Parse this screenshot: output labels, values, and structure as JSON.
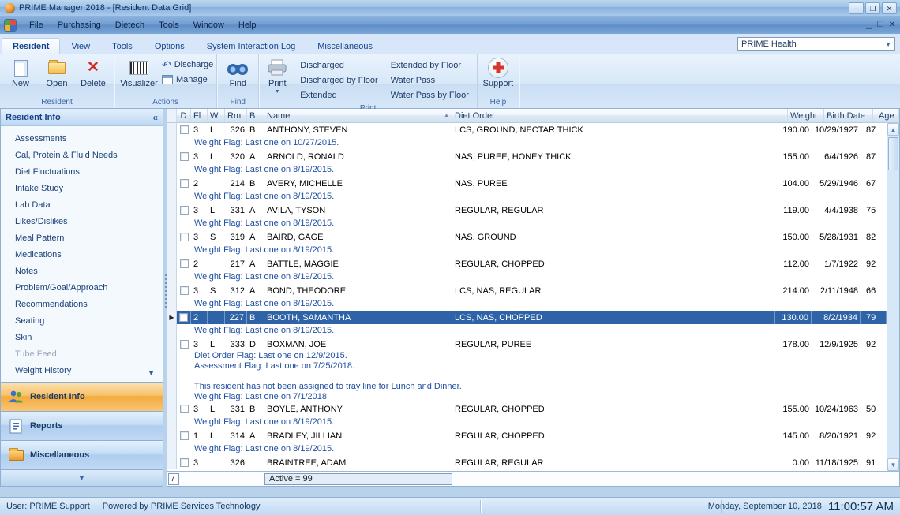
{
  "window": {
    "title": "PRIME Manager 2018 - [Resident Data Grid]"
  },
  "menu": {
    "items": [
      "File",
      "Purchasing",
      "Dietech",
      "Tools",
      "Window",
      "Help"
    ]
  },
  "ribbon": {
    "tabs": [
      {
        "label": "Resident",
        "active": true
      },
      {
        "label": "View",
        "active": false
      },
      {
        "label": "Tools",
        "active": false
      },
      {
        "label": "Options",
        "active": false
      },
      {
        "label": "System Interaction Log",
        "active": false
      },
      {
        "label": "Miscellaneous",
        "active": false
      }
    ],
    "profile": "PRIME Health",
    "groups": {
      "resident": {
        "label": "Resident",
        "new": "New",
        "open": "Open",
        "delete": "Delete"
      },
      "actions": {
        "label": "Actions",
        "visualizer": "Visualizer",
        "discharge": "Discharge",
        "manage": "Manage"
      },
      "find": {
        "label": "Find",
        "find": "Find"
      },
      "print": {
        "label": "Print",
        "print": "Print",
        "options": [
          "Discharged",
          "Discharged by Floor",
          "Extended",
          "Extended by Floor",
          "Water Pass",
          "Water Pass by Floor"
        ]
      },
      "help": {
        "label": "Help",
        "support": "Support"
      }
    }
  },
  "sidebar": {
    "header": "Resident Info",
    "collapse_glyph": "«",
    "items": [
      {
        "label": "Assessments"
      },
      {
        "label": "Cal, Protein & Fluid Needs"
      },
      {
        "label": "Diet Fluctuations"
      },
      {
        "label": "Intake Study"
      },
      {
        "label": "Lab Data"
      },
      {
        "label": "Likes/Dislikes"
      },
      {
        "label": "Meal Pattern"
      },
      {
        "label": "Medications"
      },
      {
        "label": "Notes"
      },
      {
        "label": "Problem/Goal/Approach"
      },
      {
        "label": "Recommendations"
      },
      {
        "label": "Seating"
      },
      {
        "label": "Skin"
      },
      {
        "label": "Tube Feed",
        "muted": true
      },
      {
        "label": "Weight History"
      }
    ],
    "nav": [
      {
        "label": "Resident Info",
        "active": true
      },
      {
        "label": "Reports",
        "active": false
      },
      {
        "label": "Miscellaneous",
        "active": false
      }
    ]
  },
  "grid": {
    "columns": [
      "D",
      "Fl",
      "W",
      "Rm",
      "B",
      "Name",
      "Diet Order",
      "Weight",
      "Birth Date",
      "Age"
    ],
    "sorted_column": "Name",
    "rows": [
      {
        "type": "data",
        "fl": "3",
        "w": "L",
        "rm": "326",
        "b": "B",
        "name": "ANTHONY, STEVEN",
        "diet": "LCS, GROUND, NECTAR THICK",
        "weight": "190.00",
        "birth": "10/29/1927",
        "age": "87"
      },
      {
        "type": "flag",
        "lines": [
          "Weight Flag: Last one on 10/27/2015."
        ]
      },
      {
        "type": "data",
        "fl": "3",
        "w": "L",
        "rm": "320",
        "b": "A",
        "name": "ARNOLD, RONALD",
        "diet": "NAS, PUREE, HONEY THICK",
        "weight": "155.00",
        "birth": "6/4/1926",
        "age": "87"
      },
      {
        "type": "flag",
        "lines": [
          "Weight Flag: Last one on 8/19/2015."
        ]
      },
      {
        "type": "data",
        "fl": "2",
        "w": "",
        "rm": "214",
        "b": "B",
        "name": "AVERY, MICHELLE",
        "diet": "NAS, PUREE",
        "weight": "104.00",
        "birth": "5/29/1946",
        "age": "67"
      },
      {
        "type": "flag",
        "lines": [
          "Weight Flag: Last one on 8/19/2015."
        ]
      },
      {
        "type": "data",
        "fl": "3",
        "w": "L",
        "rm": "331",
        "b": "A",
        "name": "AVILA, TYSON",
        "diet": "REGULAR, REGULAR",
        "weight": "119.00",
        "birth": "4/4/1938",
        "age": "75"
      },
      {
        "type": "flag",
        "lines": [
          "Weight Flag: Last one on 8/19/2015."
        ]
      },
      {
        "type": "data",
        "fl": "3",
        "w": "S",
        "rm": "319",
        "b": "A",
        "name": "BAIRD, GAGE",
        "diet": "NAS, GROUND",
        "weight": "150.00",
        "birth": "5/28/1931",
        "age": "82"
      },
      {
        "type": "flag",
        "lines": [
          "Weight Flag: Last one on 8/19/2015."
        ]
      },
      {
        "type": "data",
        "fl": "2",
        "w": "",
        "rm": "217",
        "b": "A",
        "name": "BATTLE, MAGGIE",
        "diet": "REGULAR, CHOPPED",
        "weight": "112.00",
        "birth": "1/7/1922",
        "age": "92"
      },
      {
        "type": "flag",
        "lines": [
          "Weight Flag: Last one on 8/19/2015."
        ]
      },
      {
        "type": "data",
        "fl": "3",
        "w": "S",
        "rm": "312",
        "b": "A",
        "name": "BOND, THEODORE",
        "diet": "LCS, NAS, REGULAR",
        "weight": "214.00",
        "birth": "2/11/1948",
        "age": "66"
      },
      {
        "type": "flag",
        "lines": [
          "Weight Flag: Last one on 8/19/2015."
        ]
      },
      {
        "type": "data",
        "selected": true,
        "fl": "2",
        "w": "",
        "rm": "227",
        "b": "B",
        "name": "BOOTH, SAMANTHA",
        "diet": "LCS, NAS, CHOPPED",
        "weight": "130.00",
        "birth": "8/2/1934",
        "age": "79"
      },
      {
        "type": "flag",
        "lines": [
          "Weight Flag: Last one on 8/19/2015."
        ]
      },
      {
        "type": "data",
        "fl": "3",
        "w": "L",
        "rm": "333",
        "b": "D",
        "name": "BOXMAN, JOE",
        "diet": "REGULAR, PUREE",
        "weight": "178.00",
        "birth": "12/9/1925",
        "age": "92"
      },
      {
        "type": "flag",
        "lines": [
          "Diet Order Flag: Last one on 12/9/2015.",
          "Assessment Flag: Last one on 7/25/2018.",
          "",
          "This resident has not been assigned to tray line for Lunch and Dinner.",
          "Weight Flag: Last one on 7/1/2018."
        ]
      },
      {
        "type": "data",
        "fl": "3",
        "w": "L",
        "rm": "331",
        "b": "B",
        "name": "BOYLE, ANTHONY",
        "diet": "REGULAR, CHOPPED",
        "weight": "155.00",
        "birth": "10/24/1963",
        "age": "50"
      },
      {
        "type": "flag",
        "lines": [
          "Weight Flag: Last one on 8/19/2015."
        ]
      },
      {
        "type": "data",
        "fl": "1",
        "w": "L",
        "rm": "314",
        "b": "A",
        "name": "BRADLEY, JILLIAN",
        "diet": "REGULAR, CHOPPED",
        "weight": "145.00",
        "birth": "8/20/1921",
        "age": "92"
      },
      {
        "type": "flag",
        "lines": [
          "Weight Flag: Last one on 8/19/2015."
        ]
      },
      {
        "type": "data",
        "fl": "3",
        "w": "",
        "rm": "326",
        "b": "",
        "name": "BRAINTREE, ADAM",
        "diet": "REGULAR, REGULAR",
        "weight": "0.00",
        "birth": "11/18/1925",
        "age": "91"
      }
    ],
    "footer": {
      "count": "7",
      "summary": "Active = 99"
    }
  },
  "status": {
    "user": "User: PRIME Support",
    "powered": "Powered by PRIME Services Technology",
    "date": "Monday, September 10, 2018",
    "time": "11:00:57 AM"
  }
}
